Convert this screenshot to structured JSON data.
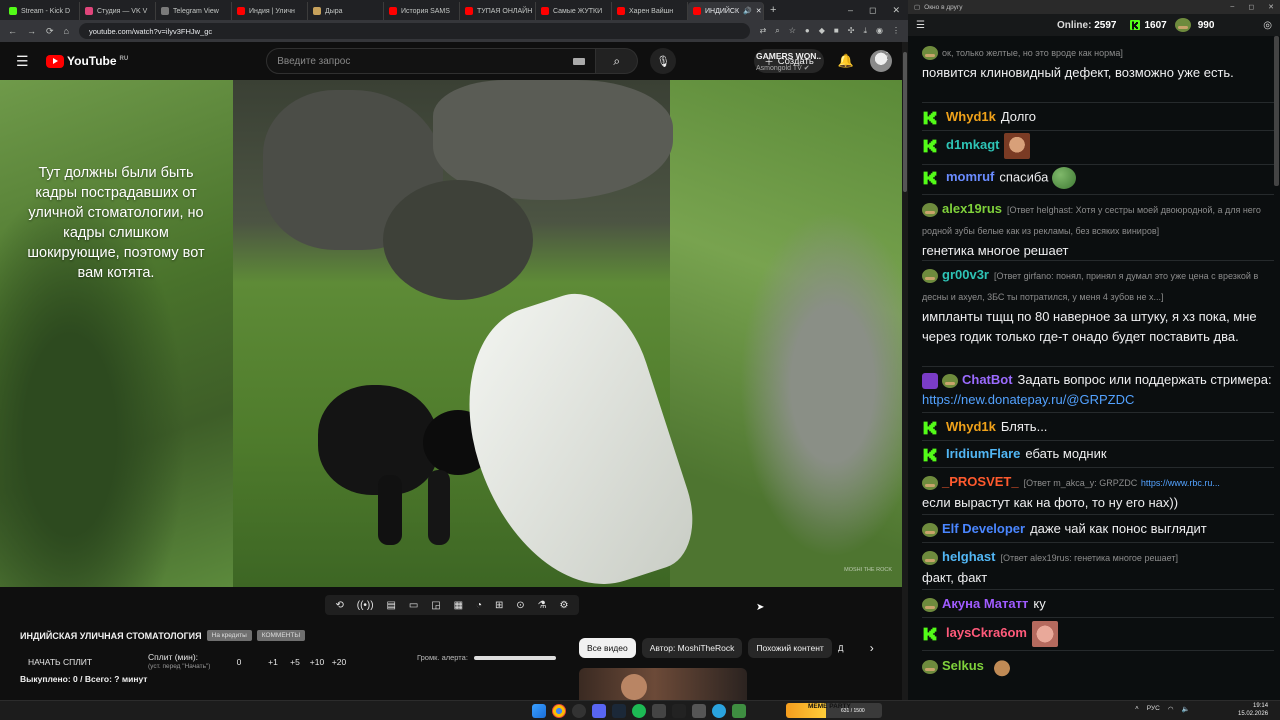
{
  "browser": {
    "tabs": [
      {
        "label": "Stream - Kick D",
        "color": "#53fc18"
      },
      {
        "label": "Студия — VK V",
        "color": "#e0457b"
      },
      {
        "label": "Telegram View",
        "color": "#7a7a7a"
      },
      {
        "label": "Индия | Уличн",
        "color": "#ff0000"
      },
      {
        "label": "Дырa",
        "color": "#c6a15b"
      },
      {
        "label": "История SAMS",
        "color": "#ff0000"
      },
      {
        "label": "ТУПАЯ ОНЛАЙН",
        "color": "#ff0000"
      },
      {
        "label": "Самые ЖУТКИ",
        "color": "#ff0000"
      },
      {
        "label": "Харен Вайшн",
        "color": "#ff0000"
      },
      {
        "label": "ИНДИЙСК",
        "color": "#ff0000"
      }
    ],
    "new_tab": "+",
    "url": "youtube.com/watch?v=ilyv3FHJw_gc",
    "window_controls": [
      "–",
      "◻",
      "✕"
    ]
  },
  "youtube": {
    "logo_text": "YouTube",
    "region": "RU",
    "search_placeholder": "Введите запрос",
    "create_label": "Создать",
    "video_overlay": "Тут должны были быть кадры пострадавших от уличной стоматологии, но кадры слишком шокирующие, поэтому вот вам котята.",
    "watermark": "MOSHI THE ROCK",
    "title": "ИНДИЙСКАЯ УЛИЧНАЯ СТОМАТОЛОГИЯ",
    "title_chips": [
      "На кредиты",
      "КОММЕНТЫ"
    ],
    "split": {
      "start_label": "НАЧАТЬ СПЛИТ",
      "minutes_label": "Сплит (мин):",
      "minutes_hint": "(уст. перед \"Начать\")",
      "minutes_value": "0",
      "increments": [
        "+1",
        "+5",
        "+10",
        "+20"
      ],
      "alert_label": "Громк. алерта:",
      "bought": "Выкуплено: 0 / Всего: ? минут"
    },
    "filter_chips": [
      "Все видео",
      "Автор: MoshiTheRock",
      "Похожий контент",
      "Д"
    ],
    "recommended": {
      "title": "GAMERS WON..",
      "channel": "Asmongold TV ✔"
    }
  },
  "chat_window": {
    "title": "Окно в другу",
    "online_label": "Online:",
    "online_count": "2597",
    "kick_count": "1607",
    "points_count": "990",
    "messages": [
      {
        "id": "m0",
        "name": "",
        "color": "#efeff1",
        "badge": "none",
        "reply": "ок, только желтые, но это вроде как норма]",
        "text": "появится клиновидный дефект, возможно уже есть."
      },
      {
        "id": "m1",
        "name": "Whyd1k",
        "color": "#f0a21a",
        "badge": "kick",
        "reply": "",
        "text": "Долго"
      },
      {
        "id": "m2",
        "name": "d1mkagt",
        "color": "#2ec4b6",
        "badge": "kick",
        "reply": "",
        "text": ""
      },
      {
        "id": "m3",
        "name": "momruf",
        "color": "#6a8cff",
        "badge": "kick",
        "reply": "",
        "text": "спасиба"
      },
      {
        "id": "m4",
        "name": "alex19rus",
        "color": "#7fd13b",
        "badge": "pepe",
        "reply": "[Ответ helghast: Хотя у сестры моей двоюродной, а для него родной зубы белые как из рекламы, без всяких виниров]",
        "text": "генетика многое решает"
      },
      {
        "id": "m5",
        "name": "gr00v3r",
        "color": "#2ec4b6",
        "badge": "pepe",
        "reply": "[Ответ girfano: понял, принял я думал это уже цена с врезкой в десны и ахуел, 3БС ты потратился, у меня 4 зубов не х...]",
        "text": "импланты тщщ по 80 наверное за штуку, я хз пока, мне через годик только где-т онадо будет поставить два."
      },
      {
        "id": "m6",
        "name": "ChatBot",
        "color": "#9b6bff",
        "badge": "bot",
        "reply": "",
        "text": "Задать вопрос или поддержать стримера:",
        "link": "https://new.donatepay.ru/@GRPZDC"
      },
      {
        "id": "m7",
        "name": "Whyd1k",
        "color": "#f0a21a",
        "badge": "kick",
        "reply": "",
        "text": "Блять..."
      },
      {
        "id": "m8",
        "name": "IridiumFlare",
        "color": "#52b7f5",
        "badge": "kick",
        "reply": "",
        "text": "ебать модник"
      },
      {
        "id": "m9",
        "name": "_PROSVET_",
        "color": "#ff5a2e",
        "badge": "pepe",
        "reply": "[Ответ m_akca_y: GRPZDC",
        "link": "https://www.rbc.ru...",
        "text": "если вырастут как на фото, то ну его нах))"
      },
      {
        "id": "m10",
        "name": "Elf Developer",
        "color": "#4a86ff",
        "badge": "pepe",
        "reply": "",
        "text": "даже чай как понос выглядит"
      },
      {
        "id": "m11",
        "name": "helghast",
        "color": "#52b7f5",
        "badge": "pepe",
        "reply": "[Ответ alex19rus: генетика многое решает]",
        "text": "факт, факт"
      },
      {
        "id": "m12",
        "name": "Акуна Мататт",
        "color": "#a05bff",
        "badge": "pepe",
        "reply": "",
        "text": "ку"
      },
      {
        "id": "m13",
        "name": "laysCkra6om",
        "color": "#ff5a7a",
        "badge": "kick",
        "reply": "",
        "text": ""
      },
      {
        "id": "m14",
        "name": "Selkus",
        "color": "#7fd13b",
        "badge": "pepe",
        "reply": "",
        "text": ""
      }
    ]
  },
  "taskbar": {
    "meme_label": "MEME PARTY",
    "meme_count": "631 / 1500",
    "meme_progress": 0.42,
    "lang": "РУС",
    "time": "19:14",
    "date": "15.02.2026"
  }
}
